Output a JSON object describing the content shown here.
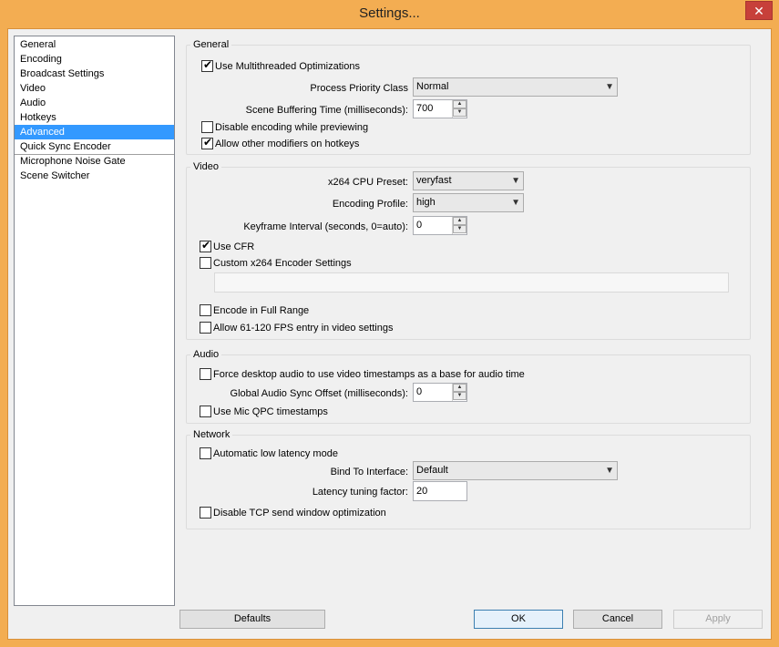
{
  "window": {
    "title": "Settings...",
    "close_label": "✕"
  },
  "sidebar": {
    "items": [
      "General",
      "Encoding",
      "Broadcast Settings",
      "Video",
      "Audio",
      "Hotkeys",
      "Advanced",
      "Quick Sync Encoder",
      "Microphone Noise Gate",
      "Scene Switcher"
    ],
    "selected": "Advanced"
  },
  "general": {
    "label": "General",
    "multithreaded": {
      "label": "Use Multithreaded Optimizations",
      "checked": true
    },
    "priority": {
      "label": "Process Priority Class",
      "value": "Normal"
    },
    "buffering": {
      "label": "Scene Buffering Time (milliseconds):",
      "value": "700"
    },
    "disable_preview": {
      "label": "Disable encoding while previewing",
      "checked": false
    },
    "modifiers": {
      "label": "Allow other modifiers on hotkeys",
      "checked": true
    }
  },
  "video": {
    "label": "Video",
    "preset": {
      "label": "x264 CPU Preset:",
      "value": "veryfast"
    },
    "profile": {
      "label": "Encoding Profile:",
      "value": "high"
    },
    "keyframe": {
      "label": "Keyframe Interval (seconds, 0=auto):",
      "value": "0"
    },
    "cfr": {
      "label": "Use CFR",
      "checked": true
    },
    "custom": {
      "label": "Custom x264 Encoder Settings",
      "checked": false,
      "value": ""
    },
    "full_range": {
      "label": "Encode in Full Range",
      "checked": false
    },
    "high_fps": {
      "label": "Allow 61-120 FPS entry in video settings",
      "checked": false
    }
  },
  "audio": {
    "label": "Audio",
    "force_ts": {
      "label": "Force desktop audio to use video timestamps as a base for audio time",
      "checked": false
    },
    "sync_offset": {
      "label": "Global Audio Sync Offset (milliseconds):",
      "value": "0"
    },
    "mic_qpc": {
      "label": "Use Mic QPC timestamps",
      "checked": false
    }
  },
  "network": {
    "label": "Network",
    "low_latency": {
      "label": "Automatic low latency mode",
      "checked": false
    },
    "bind": {
      "label": "Bind To Interface:",
      "value": "Default"
    },
    "tuning": {
      "label": "Latency tuning factor:",
      "value": "20"
    },
    "tcp": {
      "label": "Disable TCP send window optimization",
      "checked": false
    }
  },
  "buttons": {
    "defaults": "Defaults",
    "ok": "OK",
    "cancel": "Cancel",
    "apply": "Apply"
  },
  "icons": {
    "dropdown": "▼",
    "spin_up": "▲",
    "spin_down": "▼"
  }
}
